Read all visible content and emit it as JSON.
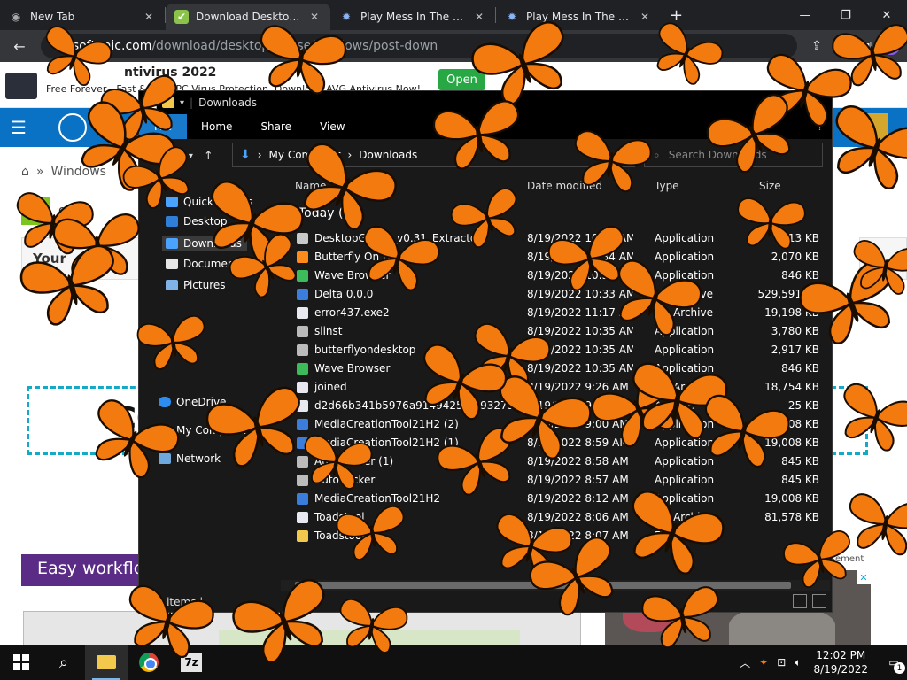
{
  "browser": {
    "tabs": [
      {
        "title": "New Tab",
        "icon": "chrome-icon",
        "active": false
      },
      {
        "title": "Download Desktop Go",
        "icon": "softonic-icon",
        "active": true
      },
      {
        "title": "Play Mess In The Mall",
        "icon": "game-icon",
        "active": false
      },
      {
        "title": "Play Mess In The Mall",
        "icon": "game-icon",
        "active": false
      }
    ],
    "new_tab_label": "+",
    "url_host": "en.softonic.com",
    "url_path": "/download/desktop-goose/windows/post-down"
  },
  "webpage": {
    "ad_title": "ntivirus 2022",
    "ad_desc": "Free Forever - Fast & Easy PC Virus Protection. Download AVG Antivirus Now!",
    "ad_button": "Open",
    "breadcrumb_home": "⌂",
    "breadcrumb_sep": "»",
    "breadcrumb_item": "Windows",
    "app_name_fragment": "ow",
    "your_box_label": "Your",
    "dashed_box_text": "CO",
    "workflow_heading": "Easy workflow",
    "advert_label": "isement"
  },
  "explorer": {
    "title": "Downloads",
    "ribbon": {
      "file": "File",
      "tabs": [
        "Home",
        "Share",
        "View"
      ],
      "help": "?"
    },
    "address": {
      "root": "My Computer",
      "sep": "›",
      "current": "Downloads"
    },
    "search_placeholder": "Search Downloads",
    "sidebar": [
      {
        "label": "Quick access",
        "icon": "star-icon",
        "color": "#4aa3ff"
      },
      {
        "label": "Desktop",
        "icon": "desktop-icon",
        "color": "#2f7fd8"
      },
      {
        "label": "Downloads",
        "icon": "download-icon",
        "color": "#4aa3ff"
      },
      {
        "label": "Documents",
        "icon": "document-icon",
        "color": "#e6e6e6"
      },
      {
        "label": "Pictures",
        "icon": "pictures-icon",
        "color": "#7fb3e8"
      },
      {
        "label": "OneDrive",
        "icon": "cloud-icon",
        "color": "#2d8cf0"
      },
      {
        "label": "My Computer",
        "icon": "computer-icon",
        "color": "#9fc5ef"
      },
      {
        "label": "Network",
        "icon": "network-icon",
        "color": "#6fa8dc"
      }
    ],
    "columns": {
      "name": "Name",
      "date": "Date modified",
      "type": "Type",
      "size": "Size"
    },
    "group": "Today (17)",
    "files": [
      {
        "name": "DesktopGoose_v0.31_Extractor",
        "date": "8/19/2022 10:41 AM",
        "type": "Application",
        "size": "13 KB",
        "icon_color": "#c9c9c9"
      },
      {
        "name": "Butterfly On Desktop",
        "date": "8/19/2022 10:34 AM",
        "type": "Application",
        "size": "2,070 KB",
        "icon_color": "#ff8c1a"
      },
      {
        "name": "Wave Browser",
        "date": "8/19/2022 10:33 AM",
        "type": "Application",
        "size": "846 KB",
        "icon_color": "#3dbb5a"
      },
      {
        "name": "Delta 0.0.0",
        "date": "8/19/2022 10:33 AM",
        "type": "zip Archive",
        "size": "529,591 KB",
        "icon_color": "#3b7ddd"
      },
      {
        "name": "error437.exe2",
        "date": "8/19/2022 11:17 AM",
        "type": "zip Archive",
        "size": "19,198 KB",
        "icon_color": "#e8e8f0"
      },
      {
        "name": "siinst",
        "date": "8/19/2022 10:35 AM",
        "type": "Application",
        "size": "3,780 KB",
        "icon_color": "#bbbbbb"
      },
      {
        "name": "butterflyondesktop",
        "date": "8/19/2022 10:35 AM",
        "type": "Application",
        "size": "2,917 KB",
        "icon_color": "#bbbbbb"
      },
      {
        "name": "Wave Browser",
        "date": "8/19/2022 10:35 AM",
        "type": "Application",
        "size": "846 KB",
        "icon_color": "#3dbb5a"
      },
      {
        "name": "joined",
        "date": "8/19/2022 9:26 AM",
        "type": "zip Archive",
        "size": "18,754 KB",
        "icon_color": "#e8e8f0"
      },
      {
        "name": "d2d66b341b5976a9149425f5193279187f",
        "date": "8/19/2022 9:02 AM",
        "type": "Archive",
        "size": "25 KB",
        "icon_color": "#e8e8f0"
      },
      {
        "name": "MediaCreationTool21H2 (2)",
        "date": "8/19/2022 9:00 AM",
        "type": "Application",
        "size": "19,008 KB",
        "icon_color": "#3b7ddd"
      },
      {
        "name": "MediaCreationTool21H2 (1)",
        "date": "8/19/2022 8:59 AM",
        "type": "Application",
        "size": "19,008 KB",
        "icon_color": "#3b7ddd"
      },
      {
        "name": "AutoClicker (1)",
        "date": "8/19/2022 8:58 AM",
        "type": "Application",
        "size": "845 KB",
        "icon_color": "#bbbbbb"
      },
      {
        "name": "AutoClicker",
        "date": "8/19/2022 8:57 AM",
        "type": "Application",
        "size": "845 KB",
        "icon_color": "#bbbbbb"
      },
      {
        "name": "MediaCreationTool21H2",
        "date": "8/19/2022 8:12 AM",
        "type": "Application",
        "size": "19,008 KB",
        "icon_color": "#3b7ddd"
      },
      {
        "name": "Toadstool",
        "date": "8/19/2022 8:06 AM",
        "type": "zip Archive",
        "size": "81,578 KB",
        "icon_color": "#e8e8f0"
      },
      {
        "name": "Toadstool",
        "date": "8/19/2022 8:07 AM",
        "type": "File folder",
        "size": "",
        "icon_color": "#f2c94c"
      }
    ],
    "status": "17 items  |"
  },
  "taskbar": {
    "apps": [
      "start-icon",
      "search-icon",
      "file-explorer-icon",
      "chrome-icon",
      "7zip-icon"
    ],
    "sevenzip_label": "7z",
    "time": "12:02 PM",
    "date": "8/19/2022",
    "notification_count": "1"
  },
  "colors": {
    "butterfly_orange": "#f27a0f",
    "butterfly_dark": "#1a0d00"
  }
}
